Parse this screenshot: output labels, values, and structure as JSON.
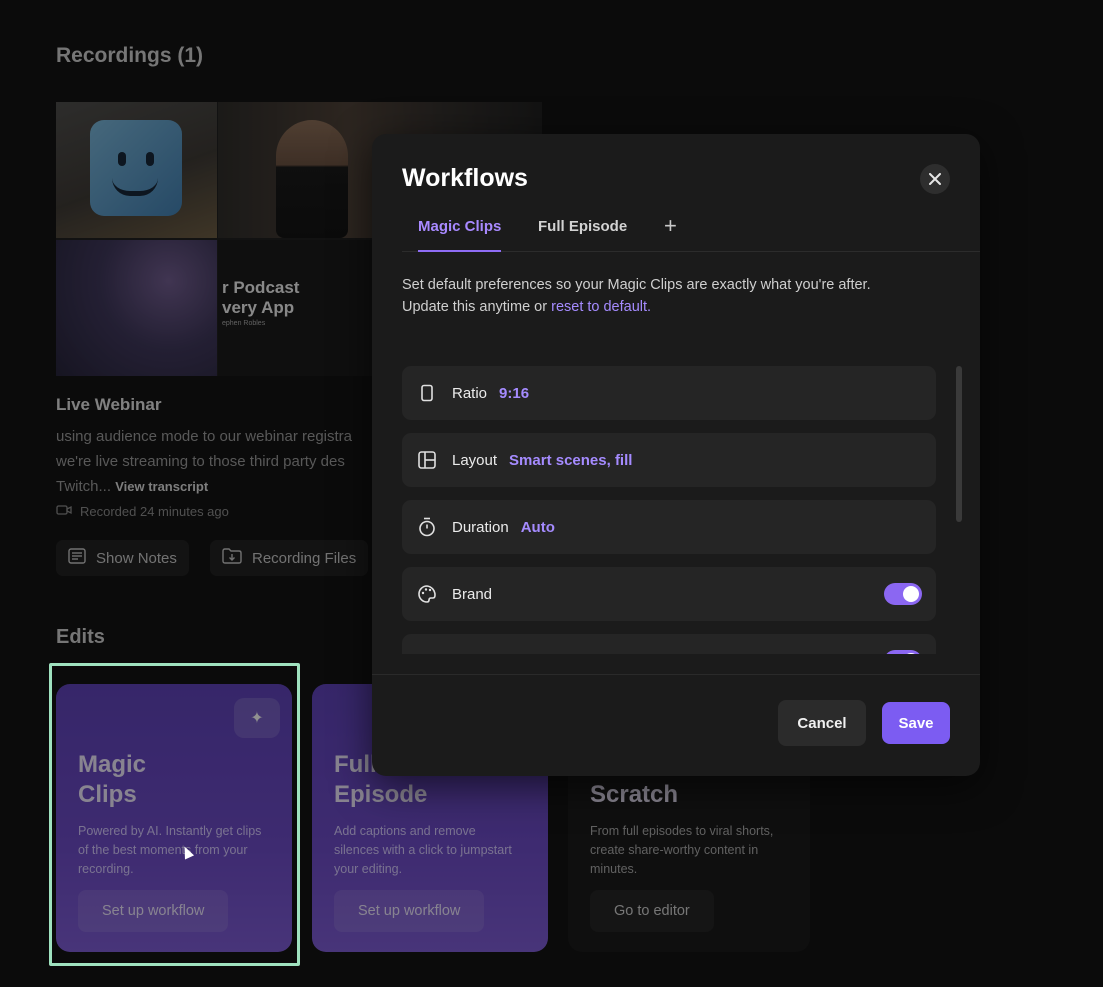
{
  "recordings": {
    "title": "Recordings (1)",
    "thumbnail": {
      "podcast_title": "r Podcast\nvery App",
      "podcast_sub": "ephen Robles"
    },
    "item": {
      "title": "Live Webinar",
      "description": "using audience mode to our webinar registra we're live streaming to those third party des Twitch...",
      "view_transcript": "View transcript",
      "recorded": "Recorded 24 minutes ago"
    },
    "buttons": {
      "show_notes": "Show Notes",
      "recording_files": "Recording Files"
    }
  },
  "edits": {
    "title": "Edits",
    "cards": [
      {
        "title": "Magic\nClips",
        "description": "Powered by AI. Instantly get clips of the best moments from your recording.",
        "button": "Set up workflow"
      },
      {
        "title": "Full\nEpisode",
        "description": "Add captions and remove silences with a click to jumpstart your editing.",
        "button": "Set up workflow"
      },
      {
        "title": "Scratch",
        "description": "From full episodes to viral shorts, create share-worthy content in minutes.",
        "button": "Go to editor"
      }
    ]
  },
  "modal": {
    "title": "Workflows",
    "close_icon": "close-icon",
    "tabs": [
      {
        "label": "Magic Clips",
        "active": true
      },
      {
        "label": "Full Episode",
        "active": false
      }
    ],
    "add_tab": "+",
    "description_line1": "Set default preferences so your Magic Clips are exactly what you're after.",
    "description_line2_prefix": "Update this anytime or ",
    "description_link": "reset to default.",
    "rows": [
      {
        "icon": "phone-ratio-icon",
        "label": "Ratio",
        "value": "9:16"
      },
      {
        "icon": "layout-icon",
        "label": "Layout",
        "value": "Smart scenes, fill"
      },
      {
        "icon": "stopwatch-icon",
        "label": "Duration",
        "value": "Auto"
      },
      {
        "icon": "palette-icon",
        "label": "Brand",
        "toggle": true
      }
    ],
    "cancel": "Cancel",
    "save": "Save"
  },
  "colors": {
    "accent": "#8b67f2",
    "accent_text": "#a58bff",
    "modal_bg": "#1b1b1b",
    "highlight": "#9fe2bf"
  }
}
